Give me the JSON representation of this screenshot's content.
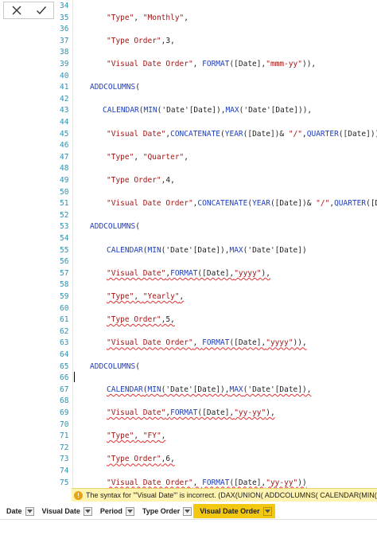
{
  "toolbar": {
    "cancel_icon": "close-icon",
    "commit_icon": "check-icon"
  },
  "editor": {
    "lines": [
      {
        "n": "34",
        "indent": 1,
        "text": "",
        "err": false
      },
      {
        "n": "35",
        "indent": 2,
        "text": "\"Type\", \"Monthly\",",
        "err": false
      },
      {
        "n": "36",
        "indent": 1,
        "text": "",
        "err": false
      },
      {
        "n": "37",
        "indent": 2,
        "text": "\"Type Order\",3,",
        "err": false
      },
      {
        "n": "38",
        "indent": 1,
        "text": "",
        "err": false
      },
      {
        "n": "39",
        "indent": 2,
        "text": "\"Visual Date Order\", FORMAT([Date],\"mmm-yy\")),",
        "err": false
      },
      {
        "n": "40",
        "indent": 1,
        "text": "",
        "err": false
      },
      {
        "n": "41",
        "indent": 1,
        "text": "ADDCOLUMNS(",
        "err": false
      },
      {
        "n": "42",
        "indent": 1,
        "text": "",
        "err": false
      },
      {
        "n": "43",
        "indent": 3,
        "text": "CALENDAR(MIN('Date'[Date]),MAX('Date'[Date])),",
        "err": false
      },
      {
        "n": "44",
        "indent": 1,
        "text": "",
        "err": false
      },
      {
        "n": "45",
        "indent": 2,
        "text": "\"Visual Date\",CONCATENATE(YEAR([Date])& \"/\",QUARTER([Date])),",
        "err": false
      },
      {
        "n": "46",
        "indent": 1,
        "text": "",
        "err": false
      },
      {
        "n": "47",
        "indent": 2,
        "text": "\"Type\", \"Quarter\",",
        "err": false
      },
      {
        "n": "48",
        "indent": 1,
        "text": "",
        "err": false
      },
      {
        "n": "49",
        "indent": 2,
        "text": "\"Type Order\",4,",
        "err": false
      },
      {
        "n": "50",
        "indent": 1,
        "text": "",
        "err": false
      },
      {
        "n": "51",
        "indent": 2,
        "text": "\"Visual Date Order\",CONCATENATE(YEAR([Date])& \"/\",QUARTER([Date])",
        "err": false
      },
      {
        "n": "52",
        "indent": 1,
        "text": "",
        "err": false
      },
      {
        "n": "53",
        "indent": 1,
        "text": "ADDCOLUMNS(",
        "err": false
      },
      {
        "n": "54",
        "indent": 1,
        "text": "",
        "err": false
      },
      {
        "n": "55",
        "indent": 2,
        "text": "CALENDAR(MIN('Date'[Date]),MAX('Date'[Date])",
        "err": false
      },
      {
        "n": "56",
        "indent": 1,
        "text": "",
        "err": false
      },
      {
        "n": "57",
        "indent": 2,
        "text": "\"Visual Date\",FORMAT([Date],\"yyyy\"),",
        "err": true
      },
      {
        "n": "58",
        "indent": 1,
        "text": "",
        "err": false
      },
      {
        "n": "59",
        "indent": 2,
        "text": "\"Type\", \"Yearly\",",
        "err": true
      },
      {
        "n": "60",
        "indent": 1,
        "text": "",
        "err": false
      },
      {
        "n": "61",
        "indent": 2,
        "text": "\"Type Order\",5,",
        "err": true
      },
      {
        "n": "62",
        "indent": 1,
        "text": "",
        "err": false
      },
      {
        "n": "63",
        "indent": 2,
        "text": "\"Visual Date Order\", FORMAT([Date],\"yyyy\")),",
        "err": true
      },
      {
        "n": "64",
        "indent": 1,
        "text": "",
        "err": false
      },
      {
        "n": "65",
        "indent": 1,
        "text": "ADDCOLUMNS(",
        "err": false
      },
      {
        "n": "66",
        "indent": 1,
        "text": "",
        "err": false
      },
      {
        "n": "67",
        "indent": 2,
        "text": "CALENDAR(MIN('Date'[Date]),MAX('Date'[Date]),",
        "err": true
      },
      {
        "n": "68",
        "indent": 1,
        "text": "",
        "err": false
      },
      {
        "n": "69",
        "indent": 2,
        "text": "\"Visual Date\",FORMAT([Date],\"yy-yy\"),",
        "err": true
      },
      {
        "n": "70",
        "indent": 1,
        "text": "",
        "err": false
      },
      {
        "n": "71",
        "indent": 2,
        "text": "\"Type\", \"FY\",",
        "err": true
      },
      {
        "n": "72",
        "indent": 1,
        "text": "",
        "err": false
      },
      {
        "n": "73",
        "indent": 2,
        "text": "\"Type Order\",6,",
        "err": true
      },
      {
        "n": "74",
        "indent": 1,
        "text": "",
        "err": false
      },
      {
        "n": "75",
        "indent": 2,
        "text": "\"Visual Date Order\", FORMAT([Date],\"yy-yy\"))",
        "err": true
      }
    ]
  },
  "error": {
    "icon": "warning-icon",
    "message": "The syntax for '\"Visual Date\"' is incorrect. (DAX(UNION( ADDCOLUMNS( CALENDAR(MIN('Date'[Da"
  },
  "fields": [
    {
      "label": "Date",
      "active": false
    },
    {
      "label": "Visual Date",
      "active": false
    },
    {
      "label": "Period",
      "active": false
    },
    {
      "label": "Type Order",
      "active": false
    },
    {
      "label": "Visual Date Order",
      "active": true
    }
  ],
  "colors": {
    "line_number": "#2b91af",
    "function": "#1f3fbf",
    "string": "#a31515",
    "error_underline": "#e03030",
    "error_bar": "#fff3b0",
    "active_field": "#f2c811"
  }
}
